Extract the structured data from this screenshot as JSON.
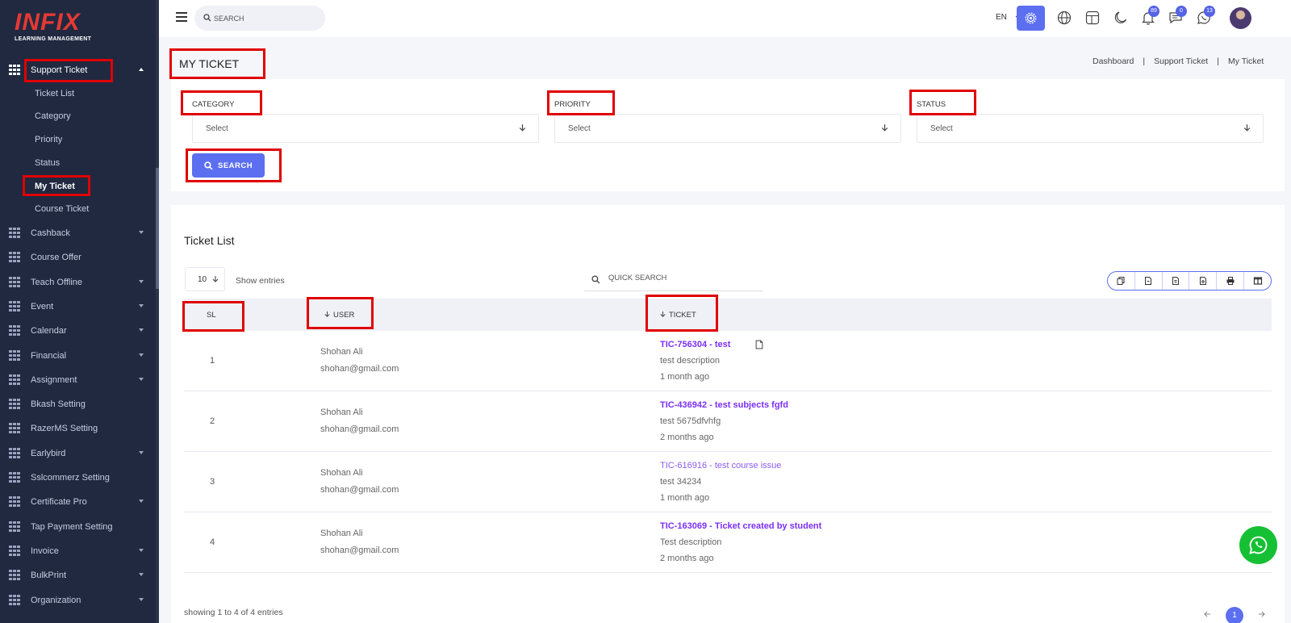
{
  "logo": {
    "main": "INFIX",
    "sub": "LEARNING MANAGEMENT"
  },
  "sidebar": {
    "active_group": "Support Ticket",
    "sub_items": [
      "Ticket List",
      "Category",
      "Priority",
      "Status",
      "My Ticket",
      "Course Ticket"
    ],
    "active_sub": "My Ticket",
    "items": [
      "Cashback",
      "Course Offer",
      "Teach Offline",
      "Event",
      "Calendar",
      "Financial",
      "Assignment",
      "Bkash Setting",
      "RazerMS Setting",
      "Earlybird",
      "Sslcommerz Setting",
      "Certificate Pro",
      "Tap Payment Setting",
      "Invoice",
      "BulkPrint",
      "Organization"
    ]
  },
  "header": {
    "search_placeholder": "SEARCH",
    "language": "EN",
    "badges": {
      "notifications": "89",
      "messages": "0",
      "chat": "13"
    },
    "icons": [
      "menu-icon",
      "search-icon",
      "gear-icon",
      "globe-icon",
      "layout-icon",
      "moon-icon",
      "bell-icon",
      "message-icon",
      "chat-icon"
    ]
  },
  "page": {
    "title": "MY TICKET",
    "breadcrumb": [
      "Dashboard",
      "Support Ticket",
      "My Ticket"
    ]
  },
  "filters": {
    "category_label": "CATEGORY",
    "priority_label": "PRIORITY",
    "status_label": "STATUS",
    "select_placeholder": "Select",
    "search_button": "SEARCH"
  },
  "ticket_list": {
    "title": "Ticket List",
    "entries_value": "10",
    "show_entries": "Show entries",
    "quick_search_placeholder": "QUICK SEARCH",
    "columns": {
      "sl": "SL",
      "user": "USER",
      "ticket": "TICKET"
    },
    "rows": [
      {
        "sl": "1",
        "name": "Shohan Ali",
        "email": "shohan@gmail.com",
        "ticket": "TIC-756304 - test",
        "desc": "test description",
        "time": "1 month ago"
      },
      {
        "sl": "2",
        "name": "Shohan Ali",
        "email": "shohan@gmail.com",
        "ticket": "TIC-436942 - test subjects fgfd",
        "desc": "test 5675dfvhfg",
        "time": "2 months ago"
      },
      {
        "sl": "3",
        "name": "Shohan Ali",
        "email": "shohan@gmail.com",
        "ticket": "TIC-616916 - test course issue",
        "desc": "test 34234",
        "time": "1 month ago"
      },
      {
        "sl": "4",
        "name": "Shohan Ali",
        "email": "shohan@gmail.com",
        "ticket": "TIC-163069 - Ticket created by student",
        "desc": "Test description",
        "time": "2 months ago"
      }
    ],
    "footer_info": "showing 1 to 4 of 4 entries",
    "current_page": "1"
  },
  "colors": {
    "sidebar_bg": "#202940",
    "accent": "#5c6ff0",
    "ticket_link": "#7b2ff7",
    "highlight": "#e00000",
    "whatsapp": "#16c035"
  }
}
